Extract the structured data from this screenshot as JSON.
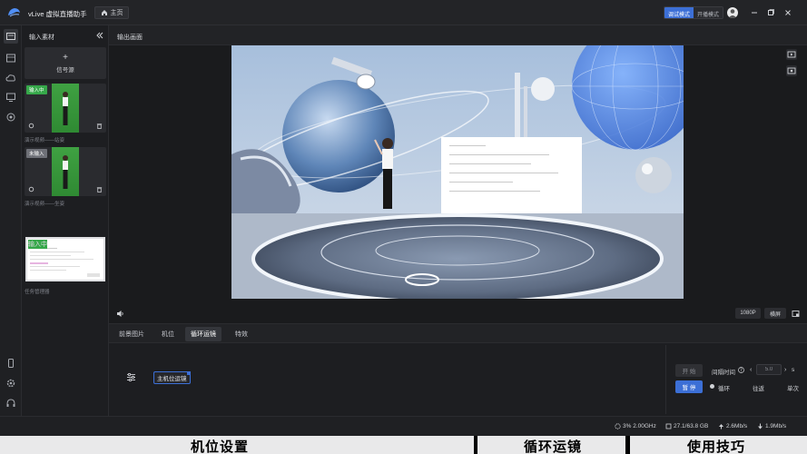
{
  "app": {
    "title": "vLive 虚拟直播助手",
    "home_tab": "主页"
  },
  "modes": [
    "调试模式",
    "开播模式"
  ],
  "input_panel": {
    "title": "输入素材",
    "add_source": "信号源",
    "sources": [
      {
        "badge": "输入中",
        "caption": "演示视频——站姿"
      },
      {
        "badge": "未输入",
        "caption": "演示视频——坐姿"
      },
      {
        "badge": "输入中",
        "caption": "任务管理器"
      }
    ]
  },
  "output": {
    "title": "输出画面",
    "resolution": "1080P",
    "orientation": "横屏"
  },
  "tabs": [
    "前景图片",
    "机位",
    "循环运镜",
    "特效"
  ],
  "camera_chip": "主机位运镜",
  "controls": {
    "start": "开 始",
    "pause": "暂 停",
    "interval_label": "间隔时间",
    "interval_value": "5.0",
    "unit": "s",
    "modes": [
      "循环",
      "往返",
      "单次"
    ]
  },
  "status": {
    "cpu": "3% 2.00GHz",
    "disk": "27.1/63.8 GB",
    "upload": "2.6Mb/s",
    "download": "1.9Mb/s"
  },
  "captions": [
    "机位设置",
    "循环运镜",
    "使用技巧"
  ],
  "colors": {
    "accent": "#3c6fd6",
    "badge_active": "#36a84a",
    "badge_idle": "#6e7077"
  }
}
